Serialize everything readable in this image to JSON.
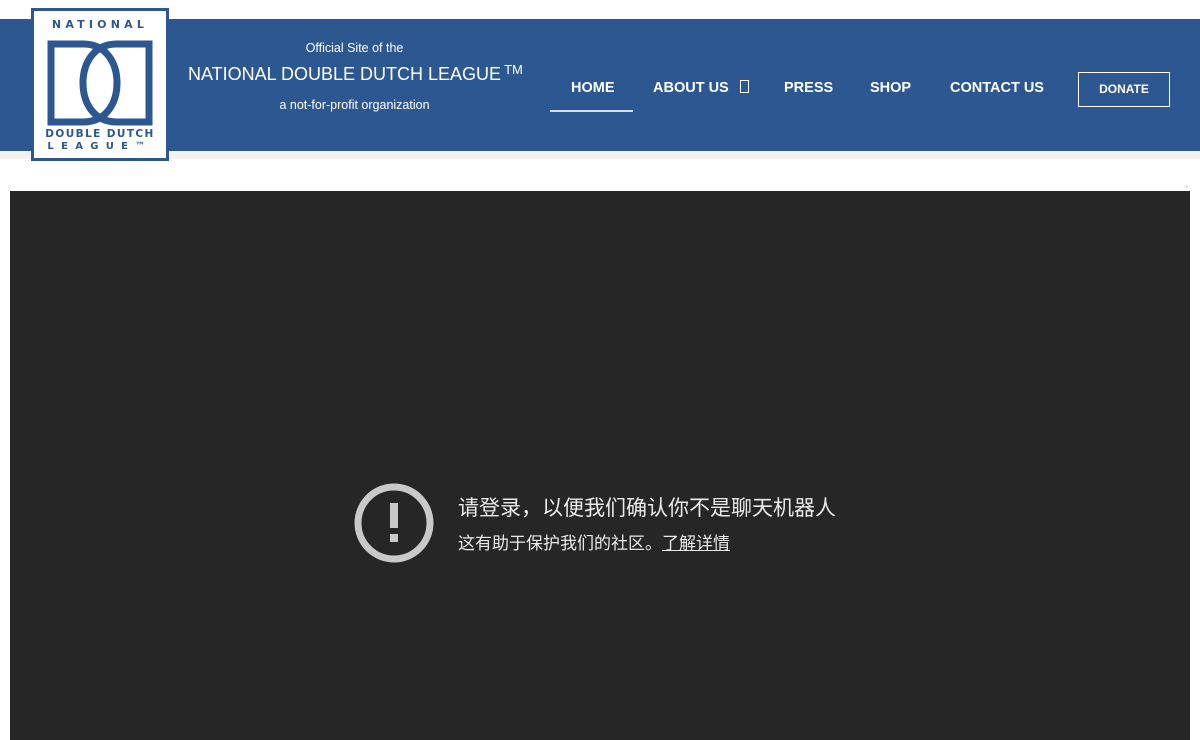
{
  "logo": {
    "top_text": "NATIONAL",
    "bottom_line1": "DOUBLE DUTCH",
    "bottom_line2": "LEAGUE™"
  },
  "branding": {
    "tagline_top": "Official Site of the",
    "site_title": "NATIONAL DOUBLE DUTCH LEAGUE",
    "trademark": "TM",
    "tagline_bottom": "a not-for-profit organization"
  },
  "nav": {
    "home": "HOME",
    "about": "ABOUT US",
    "press": "PRESS",
    "shop": "SHOP",
    "contact": "CONTACT US",
    "donate": "DONATE"
  },
  "embed": {
    "title": "请登录，以便我们确认你不是聊天机器人",
    "subtitle": "这有助于保护我们的社区。",
    "link_text": "了解详情",
    "icon": "alert-circle-icon"
  },
  "colors": {
    "header_bg": "#2d5791",
    "embed_bg": "#262626",
    "icon_color": "#c9c9c9",
    "text_light": "#eaeaea"
  }
}
